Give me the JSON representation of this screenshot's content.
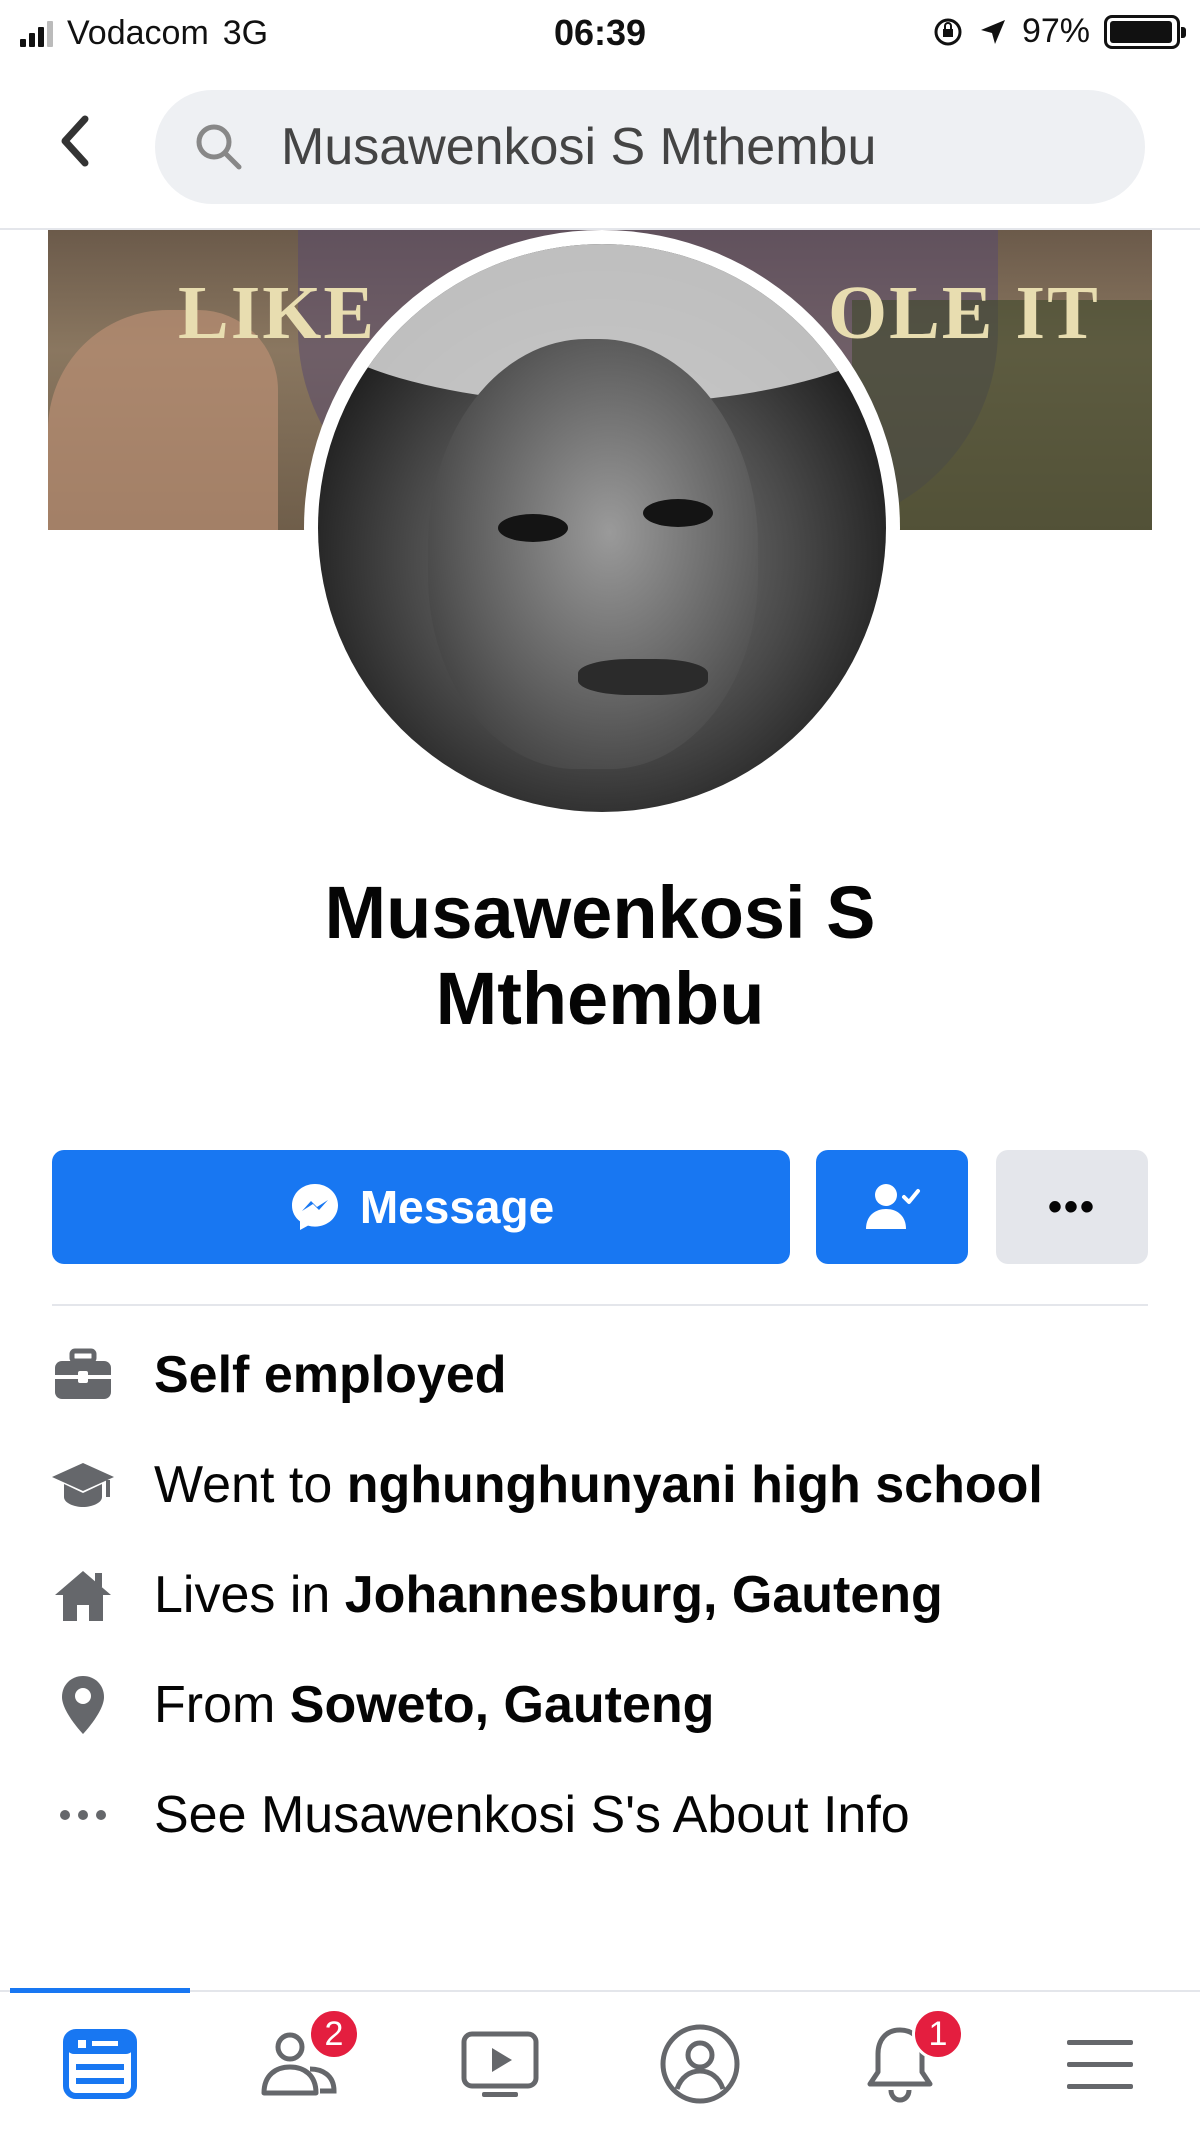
{
  "status_bar": {
    "carrier": "Vodacom",
    "network": "3G",
    "time": "06:39",
    "battery_percent": "97%",
    "battery_level": 0.97
  },
  "search": {
    "value": "Musawenkosi S Mthembu"
  },
  "cover": {
    "text_left": "LIKE",
    "text_right": "OLE IT"
  },
  "profile": {
    "name_line1": "Musawenkosi S",
    "name_line2": "Mthembu"
  },
  "actions": {
    "message_label": "Message",
    "more_label": "•••"
  },
  "details": {
    "work": {
      "text": "Self employed"
    },
    "education": {
      "prefix": "Went to ",
      "bold": "nghunghunyani high school"
    },
    "lives": {
      "prefix": "Lives in ",
      "bold": "Johannesburg, Gauteng"
    },
    "from": {
      "prefix": "From ",
      "bold": "Soweto, Gauteng"
    },
    "about": {
      "text": "See Musawenkosi S's About Info"
    }
  },
  "tabbar": {
    "friends_badge": "2",
    "notifications_badge": "1"
  },
  "colors": {
    "accent": "#1877f2",
    "badge": "#e41e3f",
    "secondary_button": "#e4e6eb",
    "icon_gray": "#65676b"
  },
  "icons": [
    "back-chevron",
    "search",
    "messenger",
    "friend-check",
    "more-dots",
    "briefcase",
    "graduation-cap",
    "home",
    "location-pin",
    "more-dots",
    "news-feed",
    "friends",
    "watch",
    "profile",
    "bell",
    "menu"
  ]
}
